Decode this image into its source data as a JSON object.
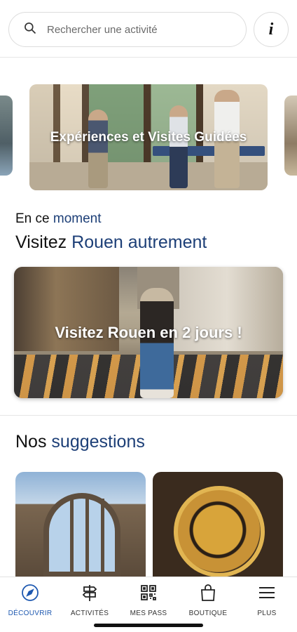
{
  "search": {
    "placeholder": "Rechercher une activité"
  },
  "info_button": {
    "label": "i"
  },
  "carousel": {
    "featured_title": "Expériences et Visites Guidées"
  },
  "moment": {
    "kicker_prefix": "En ce",
    "kicker_accent": "moment",
    "title_prefix": "Visitez",
    "title_accent": "Rouen autrement",
    "card_title": "Visitez Rouen en 2 jours !"
  },
  "suggestions": {
    "title_prefix": "Nos",
    "title_accent": "suggestions"
  },
  "nav": {
    "items": [
      {
        "label": "DÉCOUVRIR",
        "icon": "compass-icon",
        "active": true
      },
      {
        "label": "ACTIVITÉS",
        "icon": "signpost-icon",
        "active": false
      },
      {
        "label": "MES PASS",
        "icon": "qr-code-icon",
        "active": false
      },
      {
        "label": "BOUTIQUE",
        "icon": "shopping-bag-icon",
        "active": false
      },
      {
        "label": "PLUS",
        "icon": "menu-icon",
        "active": false
      }
    ]
  },
  "colors": {
    "accent": "#1d3f77",
    "nav_active": "#1d58b0"
  }
}
